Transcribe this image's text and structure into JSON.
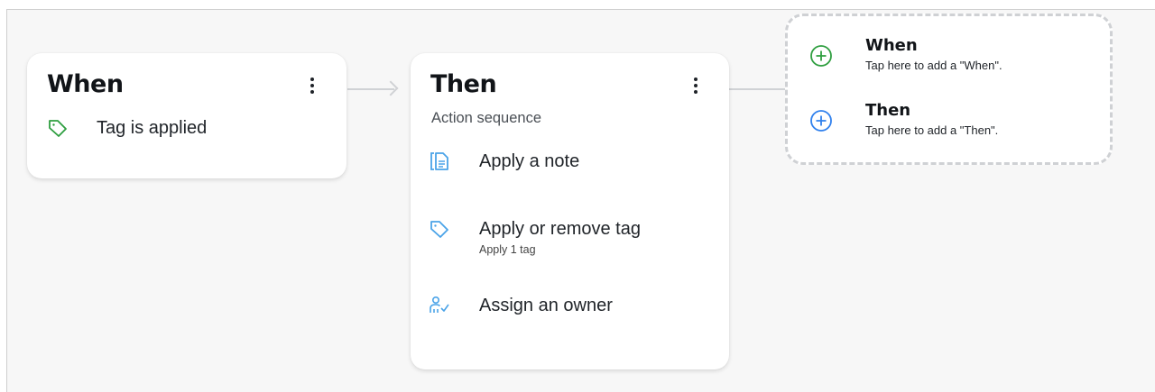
{
  "when_card": {
    "title": "When",
    "trigger_label": "Tag is applied"
  },
  "then_card": {
    "title": "Then",
    "subtitle": "Action sequence",
    "actions": [
      {
        "label": "Apply a note",
        "sub": ""
      },
      {
        "label": "Apply or remove tag",
        "sub": "Apply 1 tag"
      },
      {
        "label": "Assign an owner",
        "sub": ""
      }
    ]
  },
  "add_box": {
    "when": {
      "title": "When",
      "hint": "Tap here to add a \"When\"."
    },
    "then": {
      "title": "Then",
      "hint": "Tap here to add a \"Then\"."
    }
  },
  "icons": {
    "trigger": "tag-icon",
    "action_1": "note-icon",
    "action_2": "tag-icon",
    "action_3": "assign-owner-icon",
    "add_when": "plus-circle-icon",
    "add_then": "plus-circle-icon",
    "menu": "kebab-menu-icon"
  },
  "colors": {
    "green": "#2e9e3f",
    "blue": "#2f80ed",
    "action_blue": "#4aa3e8"
  }
}
